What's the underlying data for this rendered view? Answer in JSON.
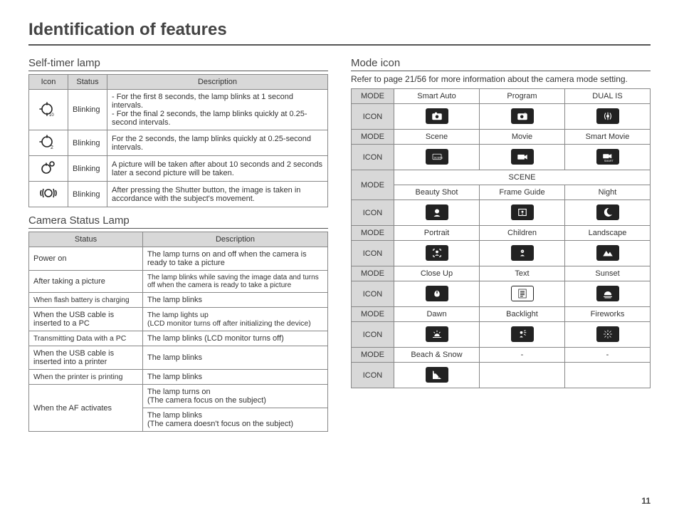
{
  "page_title": "Identification of features",
  "page_number": "11",
  "left": {
    "selftimer": {
      "heading": "Self-timer lamp",
      "headers": {
        "icon": "Icon",
        "status": "Status",
        "description": "Description"
      },
      "rows": [
        {
          "icon": "timer-10-icon",
          "status": "Blinking",
          "desc": "- For the first 8 seconds, the lamp blinks at 1 second intervals.\n- For the final 2 seconds, the lamp blinks quickly at 0.25-second intervals."
        },
        {
          "icon": "timer-2-icon",
          "status": "Blinking",
          "desc": "For the 2 seconds, the lamp blinks quickly at 0.25-second intervals."
        },
        {
          "icon": "timer-double-icon",
          "status": "Blinking",
          "desc": "A picture will be taken after about 10 seconds and 2 seconds later a second picture will be taken."
        },
        {
          "icon": "motion-timer-icon",
          "status": "Blinking",
          "desc": "After pressing the Shutter button, the image is taken in accordance with the subject's movement."
        }
      ]
    },
    "status_lamp": {
      "heading": "Camera Status Lamp",
      "headers": {
        "status": "Status",
        "description": "Description"
      },
      "rows": [
        {
          "status": "Power on",
          "desc": "The lamp turns on and off when the camera is ready to take a picture"
        },
        {
          "status": "After taking a picture",
          "desc": "The lamp blinks while saving the image data and turns off when the camera is ready to take a picture"
        },
        {
          "status": "When flash battery is charging",
          "desc": "The lamp blinks"
        },
        {
          "status": "When the USB cable is inserted to a PC",
          "desc": "The lamp lights up\n(LCD monitor turns off after initializing the device)"
        },
        {
          "status": "Transmitting Data with a PC",
          "desc": "The lamp blinks (LCD monitor turns off)"
        },
        {
          "status": "When the USB cable is inserted into a printer",
          "desc": "The lamp blinks"
        },
        {
          "status": "When the printer is printing",
          "desc": "The lamp blinks"
        },
        {
          "status": "When the AF activates",
          "desc_on": "The lamp turns on\n(The camera focus on the subject)",
          "desc_off": "The lamp blinks\n(The camera doesn't focus on the subject)"
        }
      ]
    }
  },
  "right": {
    "heading": "Mode icon",
    "refer": "Refer to page 21/56 for more information about the camera mode setting.",
    "labels": {
      "mode": "MODE",
      "icon": "ICON",
      "scene": "SCENE"
    },
    "modes_top": [
      {
        "name": "Smart Auto",
        "icon": "smart-auto-icon"
      },
      {
        "name": "Program",
        "icon": "program-icon"
      },
      {
        "name": "DUAL IS",
        "icon": "dual-is-icon"
      }
    ],
    "modes_mid": [
      {
        "name": "Scene",
        "icon": "scene-icon"
      },
      {
        "name": "Movie",
        "icon": "movie-icon"
      },
      {
        "name": "Smart Movie",
        "icon": "smart-movie-icon"
      }
    ],
    "scene_rows": [
      [
        {
          "name": "Beauty Shot",
          "icon": "beauty-shot-icon"
        },
        {
          "name": "Frame Guide",
          "icon": "frame-guide-icon"
        },
        {
          "name": "Night",
          "icon": "night-icon"
        }
      ],
      [
        {
          "name": "Portrait",
          "icon": "portrait-icon"
        },
        {
          "name": "Children",
          "icon": "children-icon"
        },
        {
          "name": "Landscape",
          "icon": "landscape-icon"
        }
      ],
      [
        {
          "name": "Close Up",
          "icon": "close-up-icon"
        },
        {
          "name": "Text",
          "icon": "text-icon"
        },
        {
          "name": "Sunset",
          "icon": "sunset-icon"
        }
      ],
      [
        {
          "name": "Dawn",
          "icon": "dawn-icon"
        },
        {
          "name": "Backlight",
          "icon": "backlight-icon"
        },
        {
          "name": "Fireworks",
          "icon": "fireworks-icon"
        }
      ],
      [
        {
          "name": "Beach & Snow",
          "icon": "beach-snow-icon"
        },
        {
          "name": "-",
          "icon": ""
        },
        {
          "name": "-",
          "icon": ""
        }
      ]
    ]
  }
}
